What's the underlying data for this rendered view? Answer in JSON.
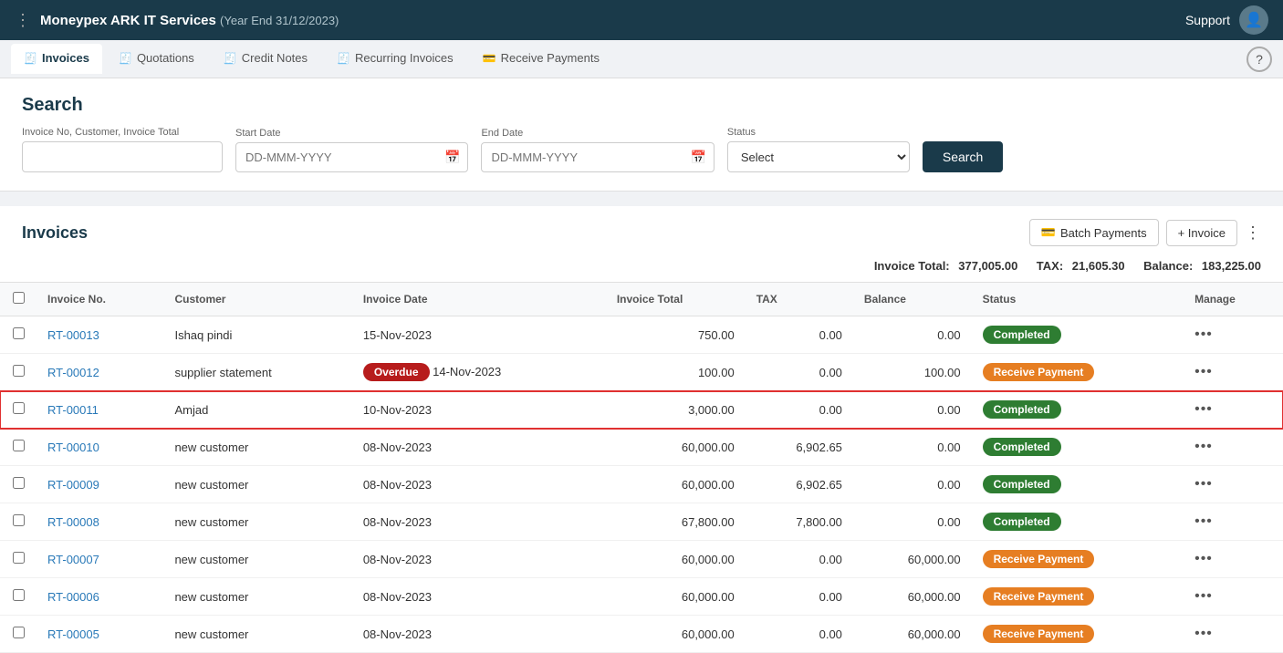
{
  "app": {
    "title": "Moneypex ARK IT Services",
    "subtitle": "(Year End 31/12/2023)",
    "support_label": "Support"
  },
  "tabs": [
    {
      "id": "invoices",
      "label": "Invoices",
      "active": true
    },
    {
      "id": "quotations",
      "label": "Quotations",
      "active": false
    },
    {
      "id": "credit-notes",
      "label": "Credit Notes",
      "active": false
    },
    {
      "id": "recurring-invoices",
      "label": "Recurring Invoices",
      "active": false
    },
    {
      "id": "receive-payments",
      "label": "Receive Payments",
      "active": false
    }
  ],
  "search": {
    "title": "Search",
    "invoice_label": "Invoice No, Customer, Invoice Total",
    "invoice_placeholder": "",
    "start_date_label": "Start Date",
    "start_date_placeholder": "DD-MMM-YYYY",
    "end_date_label": "End Date",
    "end_date_placeholder": "DD-MMM-YYYY",
    "status_label": "Status",
    "status_placeholder": "Select",
    "button_label": "Search"
  },
  "invoices": {
    "title": "Invoices",
    "batch_payments_label": "Batch Payments",
    "add_invoice_label": "+ Invoice",
    "totals": {
      "invoice_total_label": "Invoice Total:",
      "invoice_total_value": "377,005.00",
      "tax_label": "TAX:",
      "tax_value": "21,605.30",
      "balance_label": "Balance:",
      "balance_value": "183,225.00"
    },
    "columns": [
      "",
      "Invoice No.",
      "Customer",
      "Invoice Date",
      "Invoice Total",
      "TAX",
      "Balance",
      "Status",
      "Manage"
    ],
    "rows": [
      {
        "id": "RT-00013",
        "customer": "Ishaq pindi",
        "date": "15-Nov-2023",
        "overdue": false,
        "total": "750.00",
        "tax": "0.00",
        "balance": "0.00",
        "status": "Completed",
        "status_type": "completed",
        "highlighted": false
      },
      {
        "id": "RT-00012",
        "customer": "supplier statement",
        "date": "14-Nov-2023",
        "overdue": true,
        "total": "100.00",
        "tax": "0.00",
        "balance": "100.00",
        "status": "Receive Payment",
        "status_type": "receive",
        "highlighted": false
      },
      {
        "id": "RT-00011",
        "customer": "Amjad",
        "date": "10-Nov-2023",
        "overdue": false,
        "total": "3,000.00",
        "tax": "0.00",
        "balance": "0.00",
        "status": "Completed",
        "status_type": "completed",
        "highlighted": true
      },
      {
        "id": "RT-00010",
        "customer": "new customer",
        "date": "08-Nov-2023",
        "overdue": false,
        "total": "60,000.00",
        "tax": "6,902.65",
        "balance": "0.00",
        "status": "Completed",
        "status_type": "completed",
        "highlighted": false
      },
      {
        "id": "RT-00009",
        "customer": "new customer",
        "date": "08-Nov-2023",
        "overdue": false,
        "total": "60,000.00",
        "tax": "6,902.65",
        "balance": "0.00",
        "status": "Completed",
        "status_type": "completed",
        "highlighted": false
      },
      {
        "id": "RT-00008",
        "customer": "new customer",
        "date": "08-Nov-2023",
        "overdue": false,
        "total": "67,800.00",
        "tax": "7,800.00",
        "balance": "0.00",
        "status": "Completed",
        "status_type": "completed",
        "highlighted": false
      },
      {
        "id": "RT-00007",
        "customer": "new customer",
        "date": "08-Nov-2023",
        "overdue": false,
        "total": "60,000.00",
        "tax": "0.00",
        "balance": "60,000.00",
        "status": "Receive Payment",
        "status_type": "receive",
        "highlighted": false
      },
      {
        "id": "RT-00006",
        "customer": "new customer",
        "date": "08-Nov-2023",
        "overdue": false,
        "total": "60,000.00",
        "tax": "0.00",
        "balance": "60,000.00",
        "status": "Receive Payment",
        "status_type": "receive",
        "highlighted": false
      },
      {
        "id": "RT-00005",
        "customer": "new customer",
        "date": "08-Nov-2023",
        "overdue": false,
        "total": "60,000.00",
        "tax": "0.00",
        "balance": "60,000.00",
        "status": "Receive Payment",
        "status_type": "receive",
        "highlighted": false
      }
    ]
  }
}
